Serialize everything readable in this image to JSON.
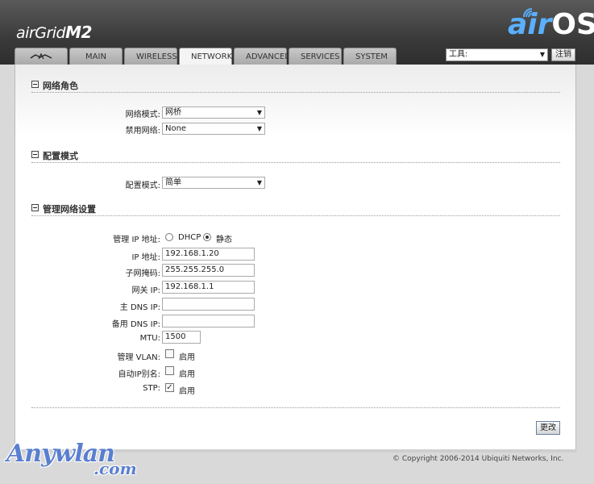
{
  "header": {
    "product_prefix": "air",
    "product_name": "Grid",
    "product_suffix": "M2",
    "logo_air": "air",
    "logo_os": "OS",
    "logo_tm": "™"
  },
  "tabs": [
    {
      "label": "",
      "icon": "ubiquiti-logo-icon"
    },
    {
      "label": "MAIN"
    },
    {
      "label": "WIRELESS"
    },
    {
      "label": "NETWORK",
      "active": true
    },
    {
      "label": "ADVANCED"
    },
    {
      "label": "SERVICES"
    },
    {
      "label": "SYSTEM"
    }
  ],
  "tools": {
    "select_value": "工具:",
    "logout_label": "注销"
  },
  "network_role": {
    "title": "网络角色",
    "network_mode_label": "网络模式:",
    "network_mode_value": "网桥",
    "disable_network_label": "禁用网络:",
    "disable_network_value": "None"
  },
  "config_mode": {
    "title": "配置模式",
    "config_mode_label": "配置模式:",
    "config_mode_value": "简单"
  },
  "management": {
    "title": "管理网络设置",
    "ip_addr_label": "管理 IP 地址:",
    "dhcp_label": "DHCP",
    "static_label": "静态",
    "ip_label": "IP 地址:",
    "ip_value": "192.168.1.20",
    "netmask_label": "子网掩码:",
    "netmask_value": "255.255.255.0",
    "gateway_label": "网关 IP:",
    "gateway_value": "192.168.1.1",
    "dns1_label": "主 DNS IP:",
    "dns1_value": "",
    "dns2_label": "备用 DNS IP:",
    "dns2_value": "",
    "mtu_label": "MTU:",
    "mtu_value": "1500",
    "vlan_label": "管理 VLAN:",
    "vlan_option": "启用",
    "alias_label": "自动IP别名:",
    "alias_option": "启用",
    "stp_label": "STP:",
    "stp_option": "启用"
  },
  "apply_label": "更改",
  "copyright": "© Copyright 2006-2014 Ubiquiti Networks, Inc.",
  "watermark": {
    "line1": "Anywlan",
    "line2": ".com"
  }
}
